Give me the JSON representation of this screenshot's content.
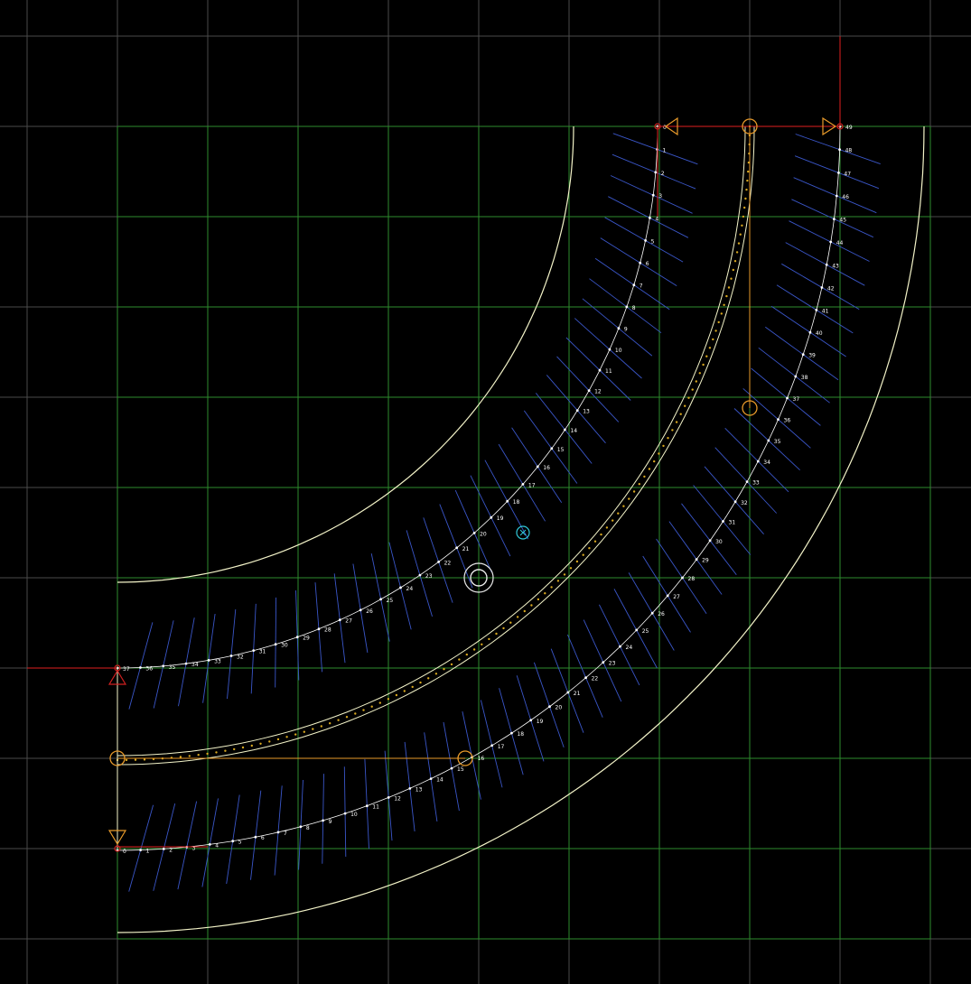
{
  "colors": {
    "background": "#000000",
    "grid_minor": "#4a4a4a",
    "grid_major": "#2e8b2e",
    "outline": "#f3f3c8",
    "centerline": "#ffffff",
    "tick": "#3a56c8",
    "axis_red": "#e02020",
    "marker_orange": "#e89a2a",
    "marker_red": "#d02020",
    "target_cyan": "#30c8d8",
    "ring": "#e8e8e8",
    "lane_divider": "#f3f3c8",
    "lane_dots": "#d8a820"
  },
  "icons": {
    "pivot": "concentric-ring-icon",
    "target": "crosshair-circle-icon",
    "endpoint": "circle-marker-icon",
    "direction": "triangle-arrow-icon"
  },
  "lanes": {
    "inner": {
      "node_labels": [
        "0",
        "1",
        "2",
        "3",
        "4",
        "5",
        "6",
        "7",
        "8",
        "9",
        "10",
        "11",
        "12",
        "13",
        "14",
        "15",
        "16",
        "17",
        "18",
        "19",
        "20",
        "21",
        "22",
        "23",
        "24",
        "25",
        "26",
        "27",
        "28",
        "29",
        "30",
        "31",
        "32",
        "33",
        "34",
        "35",
        "36",
        "37"
      ]
    },
    "outer": {
      "node_labels": [
        "0",
        "1",
        "2",
        "3",
        "4",
        "5",
        "6",
        "7",
        "8",
        "9",
        "10",
        "11",
        "12",
        "13",
        "14",
        "15",
        "16",
        "17",
        "18",
        "19",
        "20",
        "21",
        "22",
        "23",
        "24",
        "25",
        "26",
        "27",
        "28",
        "29",
        "30",
        "31",
        "32",
        "33",
        "34",
        "35",
        "36",
        "37",
        "38",
        "39",
        "40",
        "41",
        "42",
        "43",
        "44",
        "45",
        "46",
        "47",
        "48",
        "49"
      ]
    }
  }
}
